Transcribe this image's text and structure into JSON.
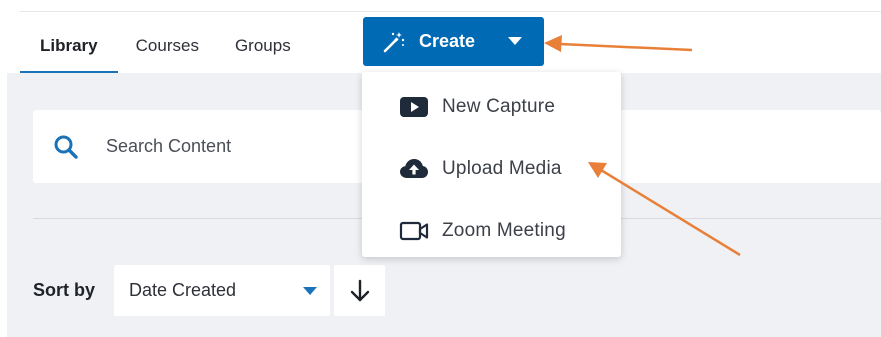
{
  "nav": {
    "tabs": [
      {
        "label": "Library",
        "active": true
      },
      {
        "label": "Courses",
        "active": false
      },
      {
        "label": "Groups",
        "active": false
      }
    ]
  },
  "create_button": {
    "label": "Create",
    "icon": "magic-wand-icon",
    "color": "#006bb4"
  },
  "create_menu": {
    "items": [
      {
        "label": "New Capture",
        "icon": "video-play-icon"
      },
      {
        "label": "Upload Media",
        "icon": "cloud-upload-icon"
      },
      {
        "label": "Zoom Meeting",
        "icon": "video-camera-icon"
      }
    ]
  },
  "search": {
    "placeholder": "Search Content",
    "icon": "search-icon"
  },
  "sort": {
    "label": "Sort by",
    "selected": "Date Created",
    "direction_icon": "arrow-down-icon"
  },
  "colors": {
    "accent": "#1a73b8",
    "annotation_arrow": "#e8803a",
    "background": "#eff1f4"
  }
}
